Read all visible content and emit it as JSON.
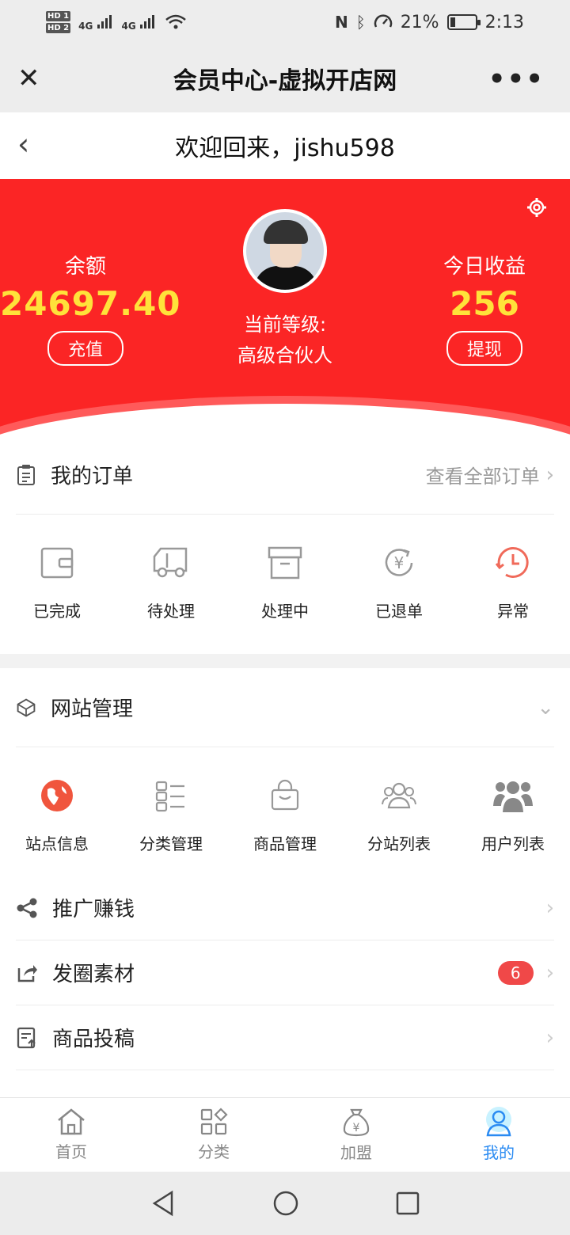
{
  "status_bar": {
    "battery": "21%",
    "time": "2:13",
    "hd1": "HD 1",
    "hd2": "HD 2",
    "net1": "4G",
    "net2": "4G"
  },
  "titlebar": {
    "title": "会员中心-虚拟开店网"
  },
  "welcome": {
    "text": "欢迎回来，jishu598"
  },
  "banner": {
    "balance_label": "余额",
    "balance_value": "24697.40",
    "recharge_label": "充值",
    "level_label": "当前等级:",
    "level_value": "高级合伙人",
    "earnings_label": "今日收益",
    "earnings_value": "256",
    "withdraw_label": "提现"
  },
  "orders": {
    "title": "我的订单",
    "view_all": "查看全部订单",
    "items": [
      {
        "label": "已完成",
        "icon": "wallet-icon"
      },
      {
        "label": "待处理",
        "icon": "truck-icon"
      },
      {
        "label": "处理中",
        "icon": "box-icon"
      },
      {
        "label": "已退单",
        "icon": "refund-icon"
      },
      {
        "label": "异常",
        "icon": "clock-icon"
      }
    ]
  },
  "site": {
    "title": "网站管理",
    "items": [
      {
        "label": "站点信息",
        "icon": "globe-icon"
      },
      {
        "label": "分类管理",
        "icon": "category-list-icon"
      },
      {
        "label": "商品管理",
        "icon": "shopping-bag-icon"
      },
      {
        "label": "分站列表",
        "icon": "users-outline-icon"
      },
      {
        "label": "用户列表",
        "icon": "users-group-icon"
      }
    ]
  },
  "menu": [
    {
      "label": "推广赚钱",
      "icon": "share-icon"
    },
    {
      "label": "发圈素材",
      "icon": "forward-icon",
      "badge": "6"
    },
    {
      "label": "商品投稿",
      "icon": "upload-doc-icon"
    }
  ],
  "tabbar": [
    {
      "label": "首页",
      "icon": "home-icon"
    },
    {
      "label": "分类",
      "icon": "category-icon"
    },
    {
      "label": "加盟",
      "icon": "money-bag-icon"
    },
    {
      "label": "我的",
      "icon": "user-icon",
      "active": true
    }
  ],
  "colors": {
    "banner_red": "#fb2525",
    "accent_yellow": "#ffe23a",
    "active_blue": "#2a8bf2",
    "badge_red": "#f04848"
  }
}
